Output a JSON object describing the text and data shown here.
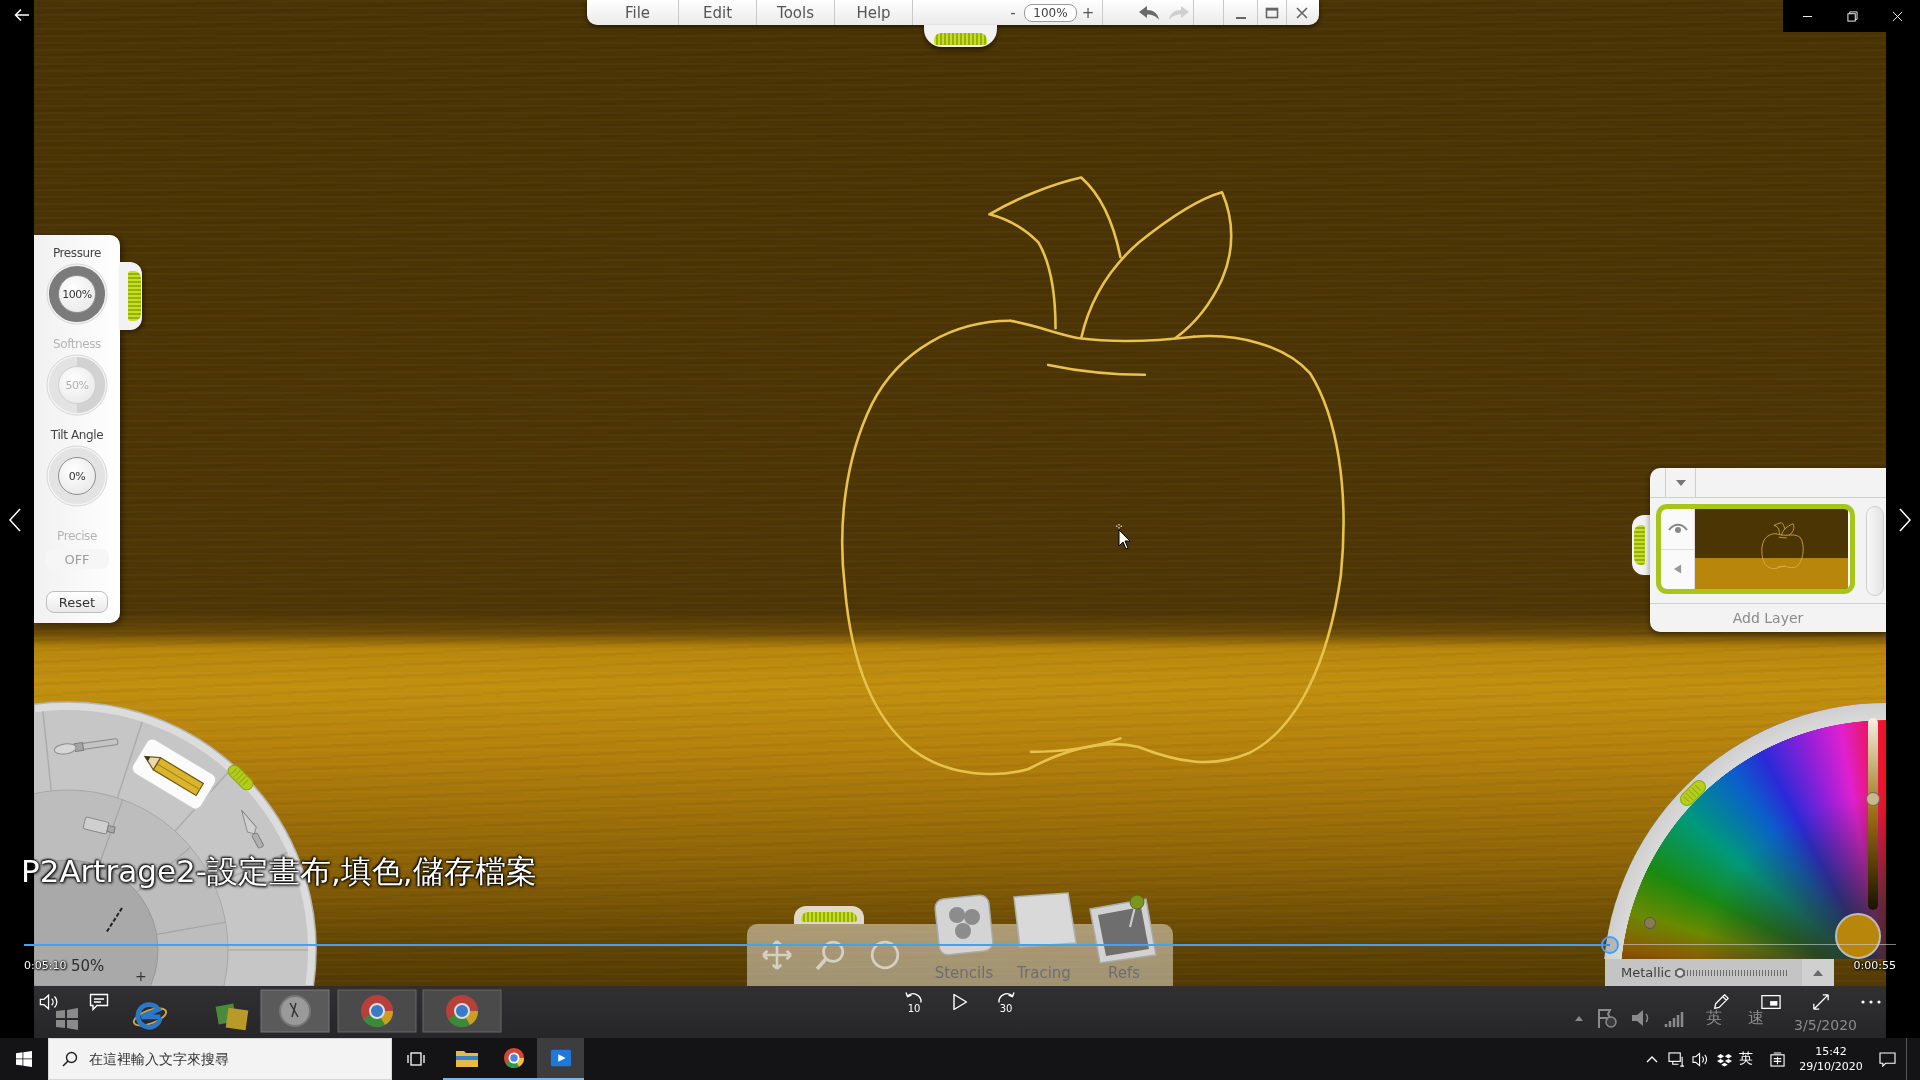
{
  "menu_bar": {
    "menus": [
      "File",
      "Edit",
      "Tools",
      "Help"
    ],
    "zoom_out": "-",
    "zoom": "100%",
    "zoom_in": "+"
  },
  "settings_panel": {
    "dials": [
      {
        "label": "Pressure",
        "value": "100%",
        "level": 1,
        "disabled": false
      },
      {
        "label": "Softness",
        "value": "50%",
        "level": 0.5,
        "disabled": true
      },
      {
        "label": "Tilt Angle",
        "value": "0%",
        "disabled": false
      }
    ],
    "precise": {
      "label": "Precise",
      "value": "OFF",
      "disabled": true
    },
    "reset": "Reset"
  },
  "layers_panel": {
    "layers": [
      {
        "selected": true
      }
    ],
    "add_layer": "Add Layer"
  },
  "tool_wheel": {
    "tools": [
      {
        "kind": "brush",
        "selected": false
      },
      {
        "kind": "pencil",
        "selected": true
      },
      {
        "kind": "knife",
        "selected": false
      },
      {
        "kind": "tube",
        "selected": false
      }
    ],
    "brush_size": "50%",
    "size_up": "+"
  },
  "bottom_tray": {
    "buttons": [
      {
        "kind": "stencils",
        "label": "Stencils"
      },
      {
        "kind": "tracing",
        "label": "Tracing"
      },
      {
        "kind": "refs",
        "label": "Refs"
      }
    ]
  },
  "color_picker": {
    "lightness": {
      "level": 0.58
    },
    "metallic": {
      "label": "Metallic",
      "level": 0
    }
  },
  "subtitle": "P2Artrage2-設定畫布,填色,儲存檔案",
  "player": {
    "level": 0.847,
    "elapsed": "0:05:10",
    "remaining": "0:00:55",
    "rewind": "10",
    "forward": "30"
  },
  "recorded_tray": {
    "ime": "英",
    "speed": "速",
    "date": "3/5/2020"
  },
  "taskbar": {
    "search": {
      "placeholder": "在這裡輸入文字來搜尋"
    },
    "apps": [
      {
        "kind": "folder",
        "running": true,
        "selected": false
      },
      {
        "kind": "chrome",
        "running": true,
        "selected": false
      },
      {
        "kind": "player",
        "running": true,
        "selected": true
      }
    ],
    "ime": "英",
    "time": "15:42",
    "date": "29/10/2020"
  }
}
